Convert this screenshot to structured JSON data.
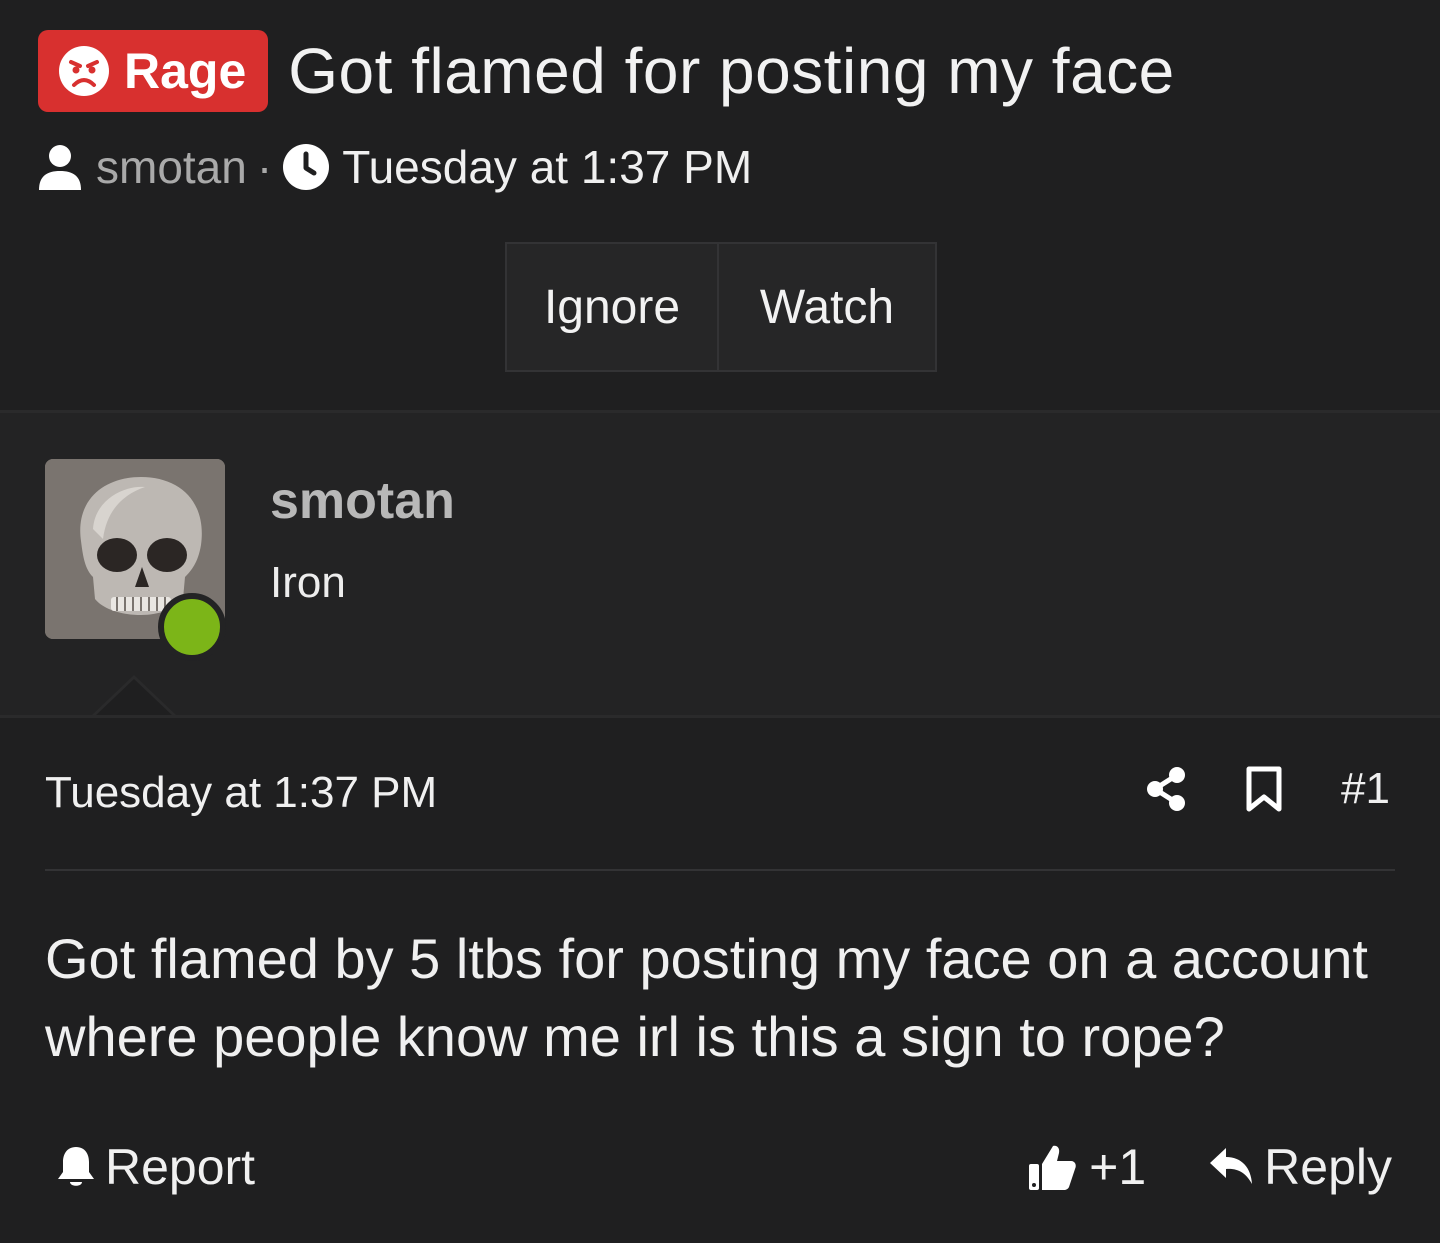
{
  "thread": {
    "prefix_label": "Rage",
    "title": "Got flamed for posting my face",
    "author": "smotan",
    "separator": "·",
    "date": "Tuesday at 1:37 PM"
  },
  "thread_actions": {
    "ignore_label": "Ignore",
    "watch_label": "Watch"
  },
  "user": {
    "name": "smotan",
    "title": "Iron",
    "status": "online",
    "status_color": "#7cb518"
  },
  "post": {
    "date": "Tuesday at 1:37 PM",
    "number": "#1",
    "body": "Got flamed by 5 ltbs for posting my face on a account where people know me irl is this a sign to rope?",
    "report_label": "Report",
    "reaction_count": "+1",
    "reply_label": "Reply"
  },
  "colors": {
    "prefix_background": "#d8302f",
    "background": "#1f1f20",
    "user_block_background": "#232324"
  },
  "icons": {
    "prefix": "angry-face-icon",
    "author": "user-icon",
    "time": "clock-icon",
    "share": "share-icon",
    "bookmark": "bookmark-icon",
    "report": "bell-icon",
    "reaction": "thumbs-up-icon",
    "reply": "reply-icon"
  }
}
